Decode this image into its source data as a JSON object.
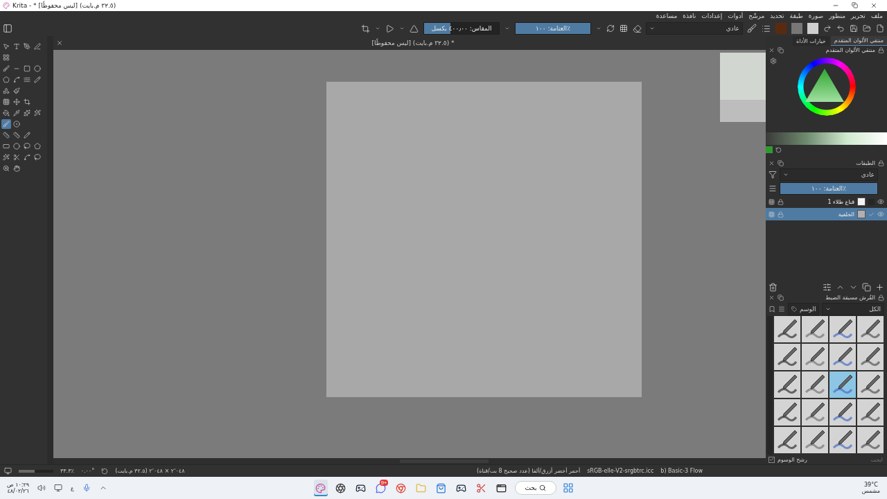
{
  "window": {
    "title": "Krita - * [ليس محفوظًا] (٣٢.٥ م.بايت)"
  },
  "menu": [
    "ملف",
    "تحرير",
    "منظور",
    "صورة",
    "طبقة",
    "تحديد",
    "مرشّح",
    "أدوات",
    "إعدادات",
    "نافذة",
    "مساعدة"
  ],
  "toolbar": {
    "scale": {
      "label": "المقاس: ٤٠٠٫٠٠ بكسل",
      "level": 0.35
    },
    "opacity": {
      "label": "العتامة: ١٠٠٪",
      "level": 1
    },
    "blend_mode": "عادي"
  },
  "toolbox": [
    [
      {
        "selected": false
      },
      {
        "selected": false
      },
      {
        "selected": false
      },
      {
        "selected": false
      }
    ],
    [
      {
        "selected": false
      }
    ],
    [
      {
        "selected": false
      },
      {
        "selected": false
      },
      {
        "selected": false
      },
      {
        "selected": false
      }
    ],
    [
      {
        "selected": false
      },
      {
        "selected": false
      },
      {
        "selected": false
      },
      {
        "selected": false
      }
    ],
    [
      {
        "selected": false
      },
      {
        "selected": false
      }
    ],
    [
      {
        "selected": false
      },
      {
        "selected": false
      },
      {
        "selected": false
      }
    ],
    [
      {
        "selected": false
      },
      {
        "selected": false
      },
      {
        "selected": false
      },
      {
        "selected": false
      }
    ],
    [
      {
        "selected": true
      },
      {
        "selected": false
      }
    ],
    [
      {
        "selected": false
      },
      {
        "selected": false
      },
      {
        "selected": false
      }
    ],
    [
      {
        "selected": false
      },
      {
        "selected": false
      },
      {
        "selected": false
      },
      {
        "selected": false
      }
    ],
    [
      {
        "selected": false
      },
      {
        "selected": false
      },
      {
        "selected": false
      },
      {
        "selected": false
      }
    ],
    [
      {
        "selected": false
      },
      {
        "selected": false
      }
    ]
  ],
  "document": {
    "tab_title": "[ليس محفوظًا] (٣٢.٥ م.بايت) *"
  },
  "dock_tabs": [
    {
      "label": "منتقي الألوان المتقدم",
      "selected": true
    },
    {
      "label": "خيارات الأداة",
      "selected": false
    }
  ],
  "color_selector": {
    "title": "منتقي الألوان المتقدم"
  },
  "layers": {
    "title": "الطبقات",
    "blend_mode": "عادي",
    "opacity": {
      "label": "العتامة: ١٠٠٪",
      "level": 1
    },
    "items": [
      {
        "name": "قناع طلاء 1",
        "selected": false,
        "visible": true
      },
      {
        "name": "الخلفية",
        "selected": true,
        "visible": true
      }
    ]
  },
  "brush_presets": {
    "title": "الفُرش مسبقة الضبط",
    "tag_filter": "الكل",
    "tag": "الوسم",
    "search_placeholder": "ابحث",
    "filter_tags": {
      "label": "رشح الوسوم",
      "checked": true
    },
    "items": [
      {
        "selected": false
      },
      {
        "selected": false
      },
      {
        "selected": false
      },
      {
        "selected": false
      },
      {
        "selected": false
      },
      {
        "selected": false
      },
      {
        "selected": false
      },
      {
        "selected": false
      },
      {
        "selected": false
      },
      {
        "selected": false
      },
      {
        "selected": true
      },
      {
        "selected": false
      },
      {
        "selected": false
      },
      {
        "selected": false
      },
      {
        "selected": false
      },
      {
        "selected": false
      },
      {
        "selected": false
      },
      {
        "selected": false
      },
      {
        "selected": false
      },
      {
        "selected": false
      }
    ]
  },
  "status_bar": {
    "zoom_slider": {
      "level": 0.45
    },
    "zoom": "٣٣.٣٪",
    "rotation": "٠.٠٠°",
    "image_size": "٢٬٠٤٨ × ٢٬٠٤٨ (٣٢.٥ م.بايت)",
    "color_profile": "sRGB-elle-V2-srgbtrc.icc",
    "color_model": "أحمر أخضر أزرق/ألفا (عدد صحيح 8 بت/قناة)",
    "brush": "b) Basic-3 Flow"
  },
  "taskbar": {
    "time": "١٠:٢٩ ص",
    "date": "٤٨/٠٢/٢٦",
    "language": "ع",
    "search": "بحث",
    "weather": {
      "temperature": "39°C",
      "condition": "مشمس"
    },
    "apps": [
      {
        "active": true
      },
      {
        "active": false
      },
      {
        "active": false
      },
      {
        "active": false,
        "badge": "9+"
      },
      {
        "active": false
      },
      {
        "active": false
      },
      {
        "active": false
      },
      {
        "active": false
      },
      {
        "active": false
      },
      {
        "active": false
      }
    ]
  }
}
